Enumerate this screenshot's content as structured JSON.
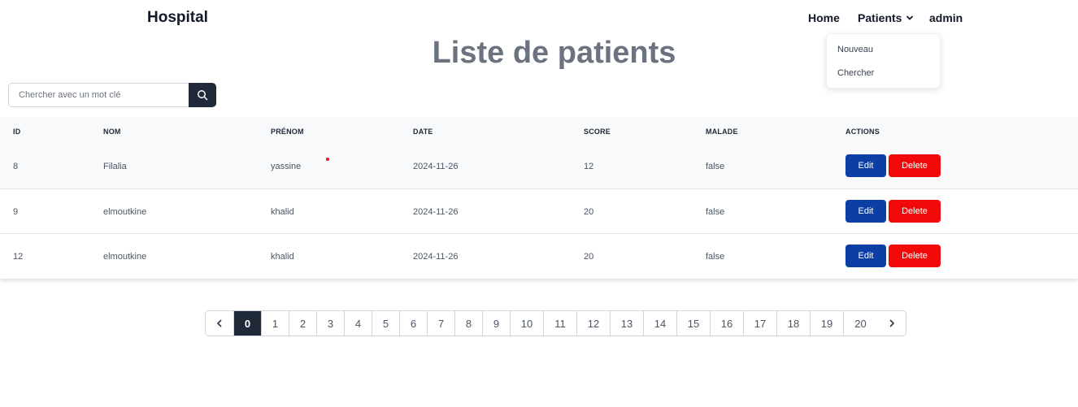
{
  "navbar": {
    "brand": "Hospital",
    "home": "Home",
    "patients": "Patients",
    "admin": "admin",
    "dropdown": [
      "Nouveau",
      "Chercher"
    ]
  },
  "title": "Liste de patients",
  "search": {
    "placeholder": "Chercher avec un mot clé",
    "value": ""
  },
  "table": {
    "headers": [
      "ID",
      "NOM",
      "PRÉNOM",
      "DATE",
      "SCORE",
      "MALADE",
      "ACTIONS"
    ],
    "rows": [
      {
        "id": "8",
        "nom": "Filalia",
        "prenom": "yassine",
        "date": "2024-11-26",
        "score": "12",
        "malade": "false"
      },
      {
        "id": "9",
        "nom": "elmoutkine",
        "prenom": "khalid",
        "date": "2024-11-26",
        "score": "20",
        "malade": "false"
      },
      {
        "id": "12",
        "nom": "elmoutkine",
        "prenom": "khalid",
        "date": "2024-11-26",
        "score": "20",
        "malade": "false"
      }
    ],
    "edit_label": "Edit",
    "delete_label": "Delete"
  },
  "pagination": {
    "pages": [
      "0",
      "1",
      "2",
      "3",
      "4",
      "5",
      "6",
      "7",
      "8",
      "9",
      "10",
      "11",
      "12",
      "13",
      "14",
      "15",
      "16",
      "17",
      "18",
      "19",
      "20"
    ],
    "current": "0"
  },
  "colors": {
    "edit": "#0b3fa5",
    "delete": "#f20a0a",
    "dark": "#1f2937"
  },
  "icons": {
    "search": "search-icon",
    "patients_chevron": "chevron-down-icon",
    "prev": "chevron-left-icon",
    "next": "chevron-right-icon"
  }
}
